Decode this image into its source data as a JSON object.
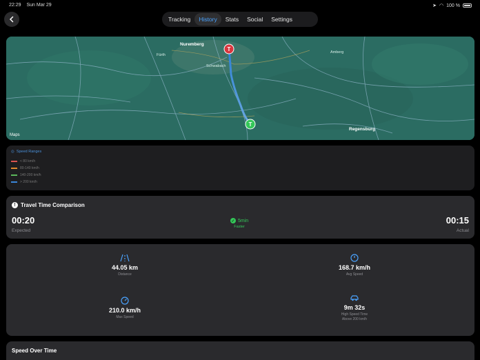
{
  "status_bar": {
    "time": "22:29",
    "date": "Sun Mar 29",
    "battery": "100 %"
  },
  "nav": {
    "tabs": [
      {
        "label": "Tracking",
        "active": false
      },
      {
        "label": "History",
        "active": true
      },
      {
        "label": "Stats",
        "active": false
      },
      {
        "label": "Social",
        "active": false
      },
      {
        "label": "Settings",
        "active": false
      }
    ]
  },
  "map": {
    "attribution": "Maps",
    "start_marker": "T",
    "end_marker": "T",
    "labels": [
      {
        "text": "Nuremberg",
        "city": true
      },
      {
        "text": "Regensburg",
        "city": true
      },
      {
        "text": "Fürth",
        "city": false
      },
      {
        "text": "Schwabach",
        "city": false
      },
      {
        "text": "Amberg",
        "city": false
      }
    ]
  },
  "legend": {
    "title": "Speed Ranges",
    "items": [
      {
        "label": "< 80 km/h",
        "color": "#d9534f"
      },
      {
        "label": "80-140 km/h",
        "color": "#e08a2e"
      },
      {
        "label": "140-200 km/h",
        "color": "#5cb85c"
      },
      {
        "label": "> 200 km/h",
        "color": "#3a86d9"
      }
    ]
  },
  "travel": {
    "title": "Travel Time Comparison",
    "expected_time": "00:20",
    "expected_label": "Expected",
    "actual_time": "00:15",
    "actual_label": "Actual",
    "difference": "5min",
    "difference_label": "Faster"
  },
  "stats": {
    "distance": {
      "value": "44.05 km",
      "label": "Distance",
      "icon": "road-icon"
    },
    "avg_speed": {
      "value": "168.7 km/h",
      "label": "Avg Speed",
      "icon": "speedometer-icon"
    },
    "max_speed": {
      "value": "210.0 km/h",
      "label": "Max Speed",
      "icon": "gauge-icon"
    },
    "high_speed_time": {
      "value": "9m 32s",
      "label": "High Speed Time",
      "sublabel": "Above 200 km/h",
      "icon": "car-icon"
    }
  },
  "speed_section": {
    "title": "Speed Over Time"
  },
  "colors": {
    "accent": "#4aa3ff",
    "positive": "#34c759",
    "panel": "#2a2a2d"
  }
}
